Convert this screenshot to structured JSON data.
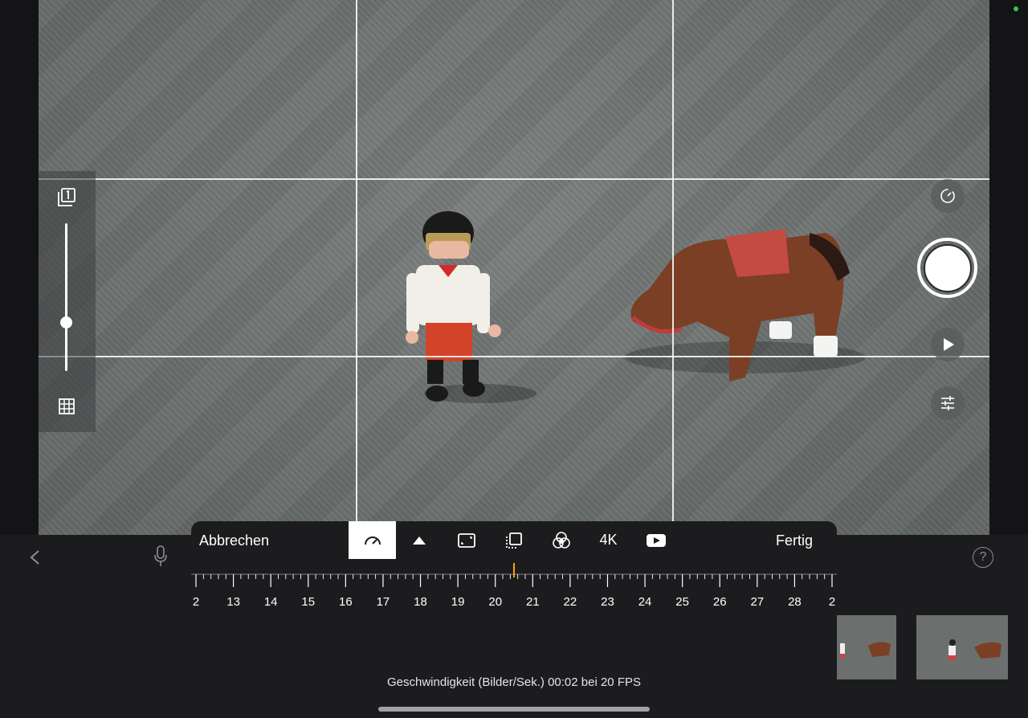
{
  "viewfinder": {
    "grid_visible": true
  },
  "left_toolbar": {
    "onion_icon": "onion-skin-1-icon",
    "opacity_level": 0.33,
    "grid_icon": "grid-icon"
  },
  "right_controls": {
    "timer_icon": "timer-icon",
    "shutter_icon": "shutter-button",
    "play_icon": "play-icon",
    "settings_icon": "sliders-icon"
  },
  "bottom_bar": {
    "back_icon": "chevron-left-icon",
    "mic_icon": "microphone-icon",
    "help_label": "?"
  },
  "speed_panel": {
    "cancel_label": "Abbrechen",
    "done_label": "Fertig",
    "tools": [
      {
        "icon": "speedometer-icon",
        "active": true
      },
      {
        "icon": "triangle-up-icon",
        "active": false
      },
      {
        "icon": "aspect-ratio-icon",
        "active": false
      },
      {
        "icon": "crop-icon",
        "active": false
      },
      {
        "icon": "color-filter-icon",
        "active": false
      },
      {
        "label": "4K",
        "active": false
      },
      {
        "icon": "youtube-icon",
        "active": false
      }
    ],
    "ruler_labels": [
      "2",
      "13",
      "14",
      "15",
      "16",
      "17",
      "18",
      "19",
      "20",
      "21",
      "22",
      "23",
      "24",
      "25",
      "26",
      "27",
      "28",
      "2"
    ],
    "selected_fps": 20,
    "status_text": "Geschwindigkeit (Bilder/Sek.) 00:02 bei 20 FPS"
  },
  "colors": {
    "accent_marker": "#ff9f0a",
    "status_dot": "#34c759",
    "panel_bg": "#1c1c1e"
  }
}
